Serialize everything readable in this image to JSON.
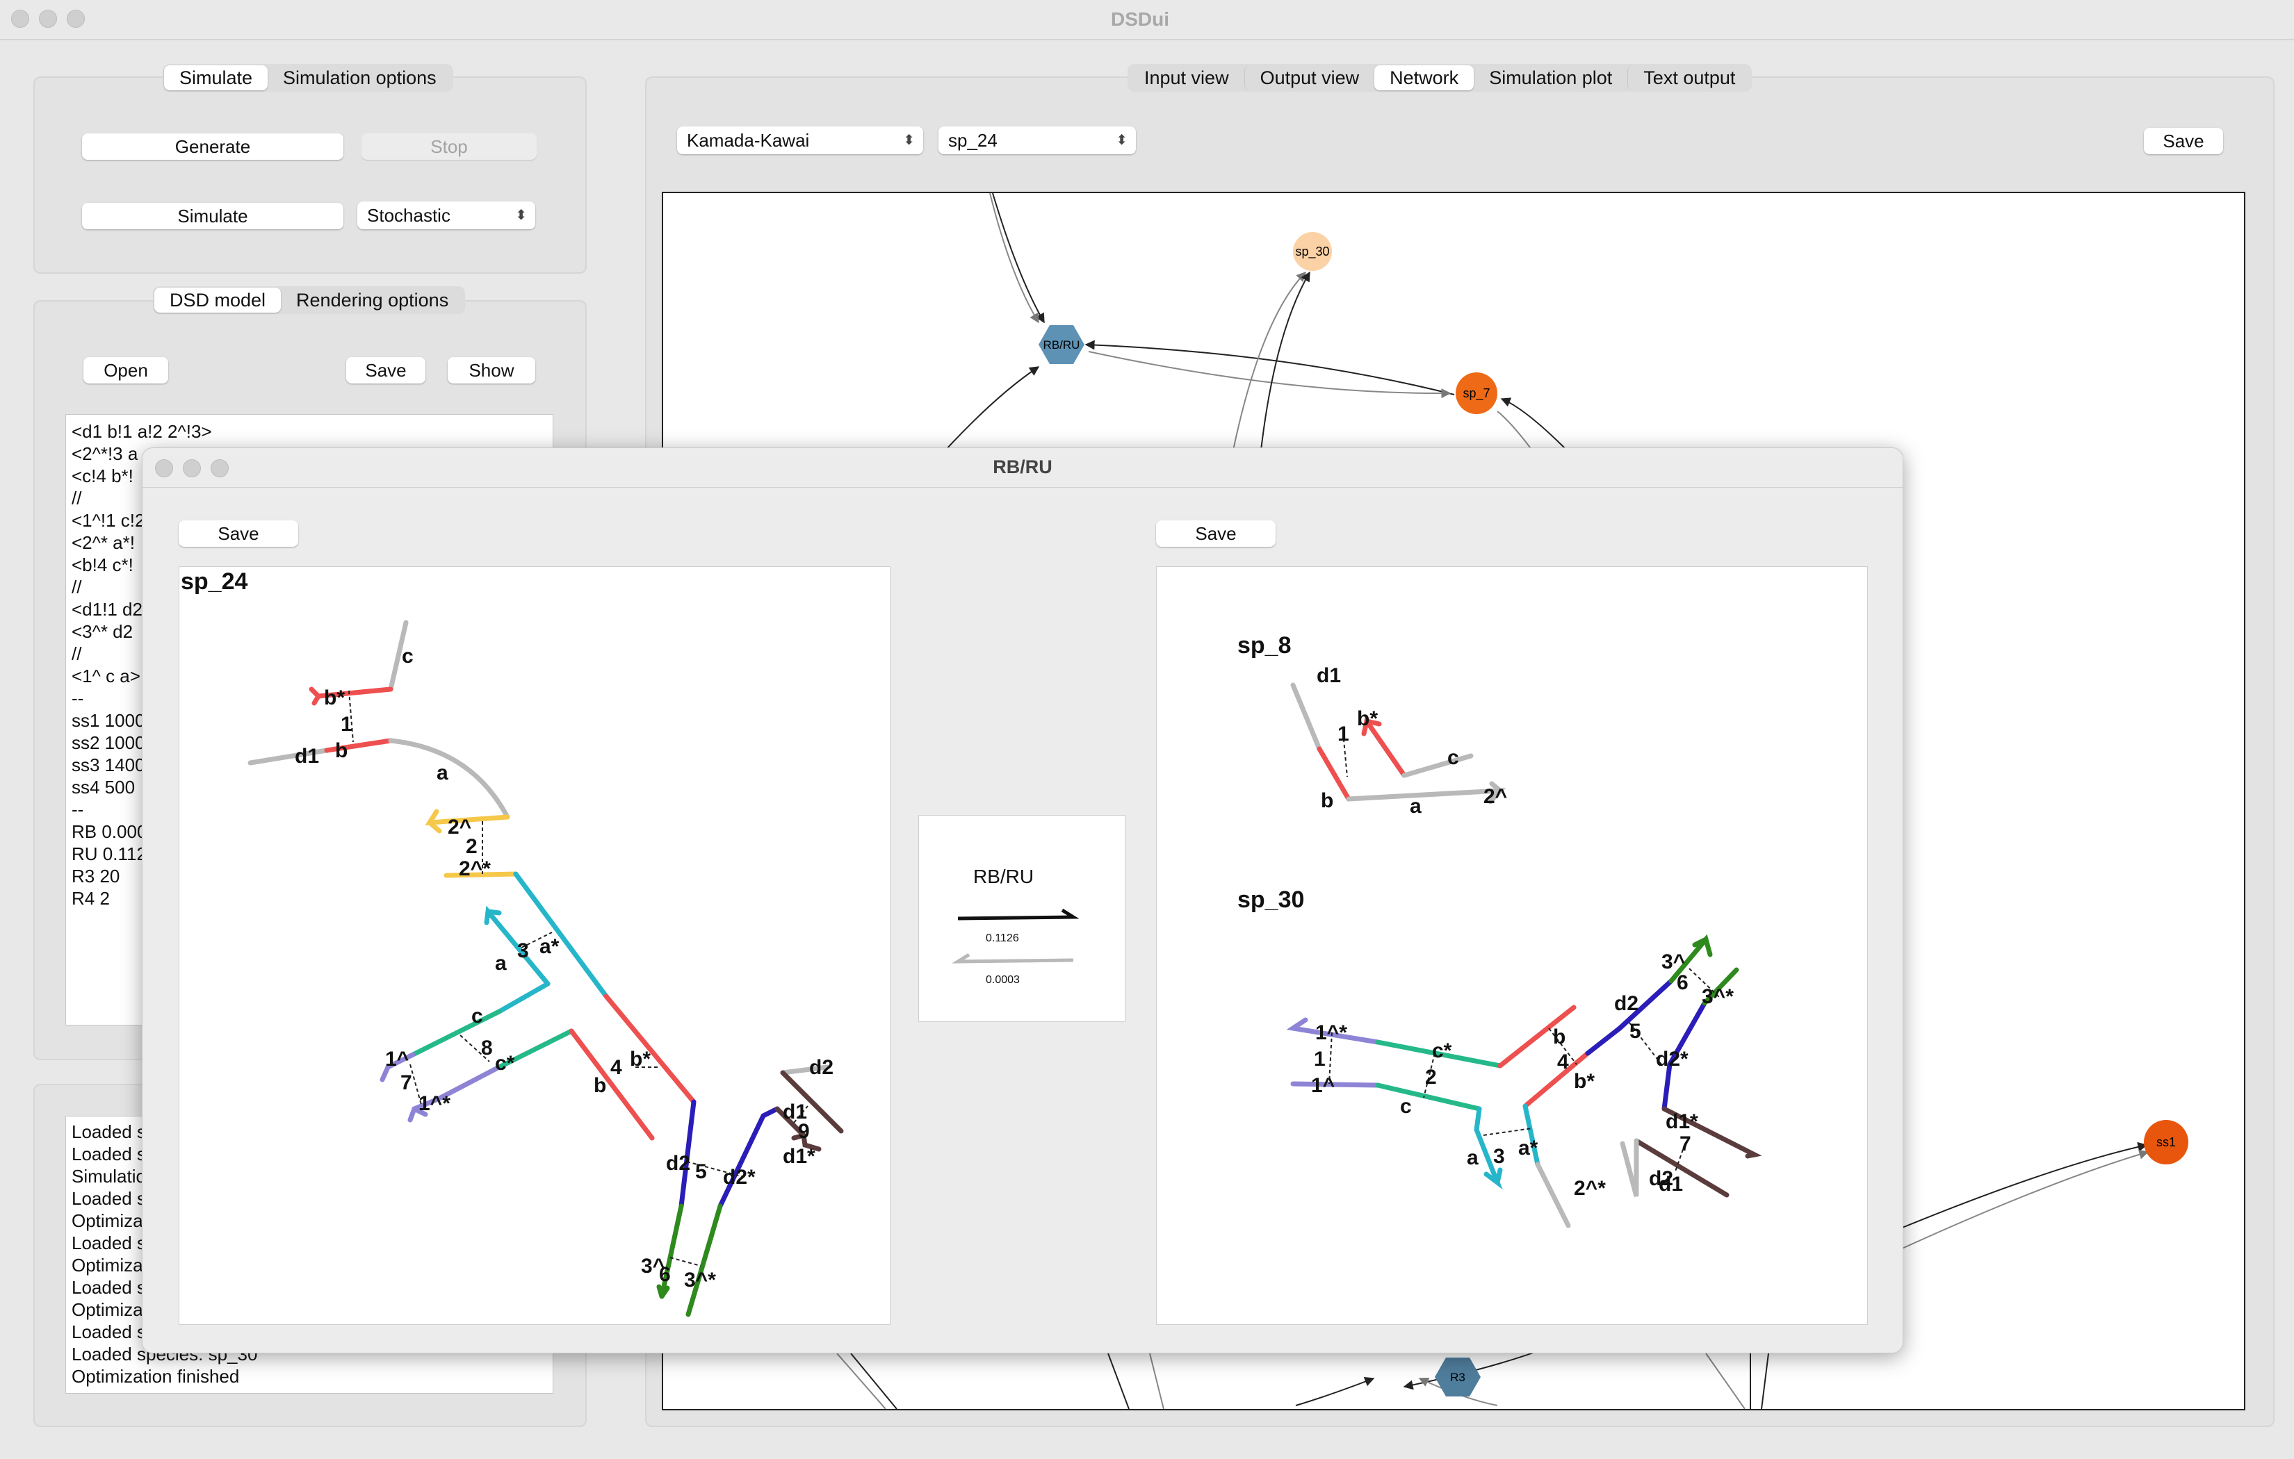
{
  "window": {
    "title": "DSDui"
  },
  "left": {
    "tabs1": [
      "Simulate",
      "Simulation options"
    ],
    "generate_label": "Generate",
    "stop_label": "Stop",
    "simulate_label": "Simulate",
    "mode_value": "Stochastic",
    "tabs2": [
      "DSD model",
      "Rendering options"
    ],
    "open_label": "Open",
    "save_label": "Save",
    "show_label": "Show",
    "model_text": [
      "<d1 b!1 a!2 2^!3>",
      "<2^*!3 a",
      "<c!4 b*!",
      "//",
      "<1^!1 c!2",
      "<2^* a*!",
      "<b!4 c*!",
      "//",
      "<d1!1 d2",
      "<3^* d2",
      "//",
      "<1^ c a>",
      "--",
      "ss1 1000",
      "ss2 1000",
      "ss3 1400",
      "ss4 500",
      "--",
      "RB 0.000",
      "RU 0.112",
      "R3 20",
      "R4 2"
    ],
    "log_lines": [
      "Loaded s",
      "Loaded s",
      "Simulatio",
      "Loaded s",
      "Optimiza",
      "Loaded s",
      "Optimiza",
      "Loaded s",
      "Optimiza",
      "Loaded s",
      "Loaded species: sp_30",
      "Optimization finished"
    ]
  },
  "right": {
    "tabs": [
      "Input view",
      "Output view",
      "Network",
      "Simulation plot",
      "Text output"
    ],
    "selected_tab": "Network",
    "layout_value": "Kamada-Kawai",
    "species_value": "sp_24",
    "save_label": "Save",
    "nodes": {
      "sp_30": "sp_30",
      "rbru": "RB/RU",
      "sp_7": "sp_7",
      "ss1": "ss1",
      "r3": "R3"
    }
  },
  "dialog": {
    "title": "RB/RU",
    "save_left": "Save",
    "save_right": "Save",
    "left_species": "sp_24",
    "right_species_top": "sp_8",
    "right_species_bottom": "sp_30",
    "reaction_name": "RB/RU",
    "forward_rate": "0.1126",
    "reverse_rate": "0.0003",
    "labels_sp24": [
      "c",
      "b*",
      "1",
      "d1",
      "b",
      "a",
      "2^",
      "2",
      "2^*",
      "a",
      "3",
      "a*",
      "c",
      "8",
      "c*",
      "1^",
      "7",
      "1^*",
      "b",
      "4",
      "b*",
      "d2",
      "5",
      "d2*",
      "3^",
      "6",
      "3^*",
      "d2",
      "d1",
      "9",
      "d1*"
    ],
    "labels_sp8": [
      "d1",
      "b*",
      "1",
      "b",
      "c",
      "a",
      "2^"
    ],
    "labels_sp30": [
      "1^*",
      "1",
      "1^",
      "c*",
      "2",
      "c",
      "b",
      "4",
      "b*",
      "a",
      "3",
      "a*",
      "2^*",
      "d2",
      "5",
      "d2*",
      "3^",
      "6",
      "3^*",
      "d1*",
      "7",
      "d2",
      "d1"
    ]
  },
  "colors": {
    "red": "#ee4f4f",
    "gray": "#b9b9b9",
    "yellow": "#f5c84a",
    "cyan": "#26b6c9",
    "green": "#25b98a",
    "lavender": "#8d84d6",
    "indigo": "#2a1db8",
    "dkgreen": "#2e8a1c",
    "brown": "#5b3c3c",
    "node_blue": "#5e92b5",
    "node_orange": "#ef6a16",
    "node_peach": "#fbd1a6"
  }
}
